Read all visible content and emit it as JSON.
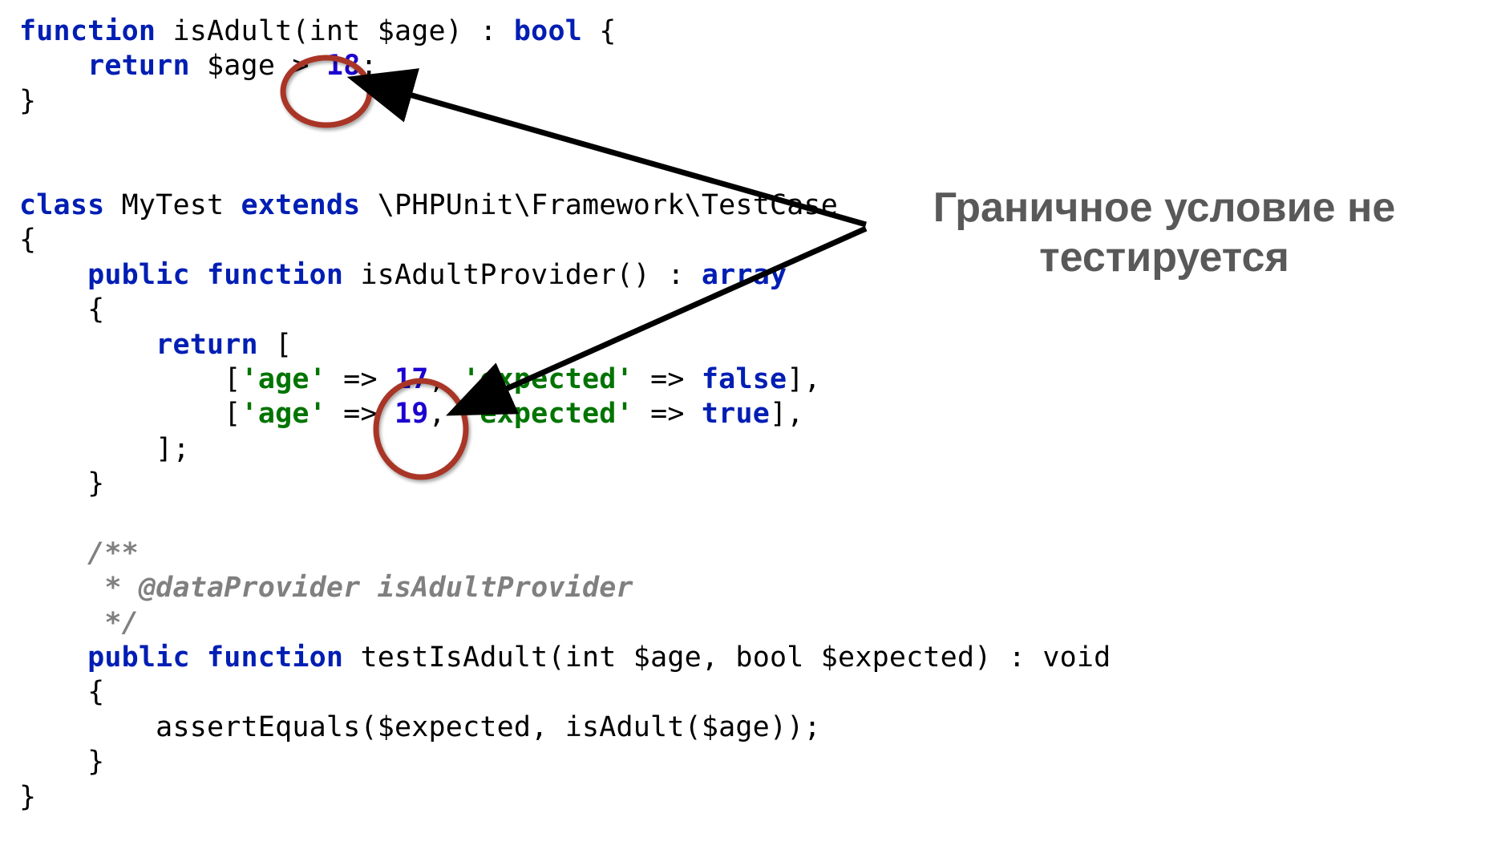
{
  "caption": {
    "line1": "Граничное условие не",
    "line2": "тестируется"
  },
  "code": {
    "l1_a": "function",
    "l1_b": " isAdult(int $age) : ",
    "l1_c": "bool",
    "l1_d": " {",
    "l2_a": "    ",
    "l2_b": "return",
    "l2_c": " $age > ",
    "l2_d": "18",
    "l2_e": ";",
    "l3": "}",
    "l4": "",
    "l5": "",
    "l6_a": "class",
    "l6_b": " MyTest ",
    "l6_c": "extends",
    "l6_d": " \\PHPUnit\\Framework\\TestCase",
    "l7": "{",
    "l8_a": "    ",
    "l8_b": "public function",
    "l8_c": " isAdultProvider() : ",
    "l8_d": "array",
    "l9": "    {",
    "l10_a": "        ",
    "l10_b": "return",
    "l10_c": " [",
    "l11_a": "            [",
    "l11_b": "'age'",
    "l11_c": " => ",
    "l11_d": "17",
    "l11_e": ", ",
    "l11_f": "'expected'",
    "l11_g": " => ",
    "l11_h": "false",
    "l11_i": "],",
    "l12_a": "            [",
    "l12_b": "'age'",
    "l12_c": " => ",
    "l12_d": "19",
    "l12_e": ", ",
    "l12_f": "'expected'",
    "l12_g": " => ",
    "l12_h": "true",
    "l12_i": "],",
    "l13": "        ];",
    "l14": "    }",
    "l15": "",
    "l16": "    /**",
    "l17_a": "     * ",
    "l17_b": "@dataProvider",
    "l17_c": " isAdultProvider",
    "l18": "     */",
    "l19_a": "    ",
    "l19_b": "public function",
    "l19_c": " testIsAdult(int $age, bool $expected) : void",
    "l20": "    {",
    "l21": "        assertEquals($expected, isAdult($age));",
    "l22": "    }",
    "l23": "}"
  },
  "annotations": {
    "circle1_desc": "red-circle-around-greater-than-18",
    "circle2_desc": "red-circle-around-17-19",
    "arrows_desc": "arrows-from-caption-to-circles",
    "stroke": "#a93526"
  }
}
